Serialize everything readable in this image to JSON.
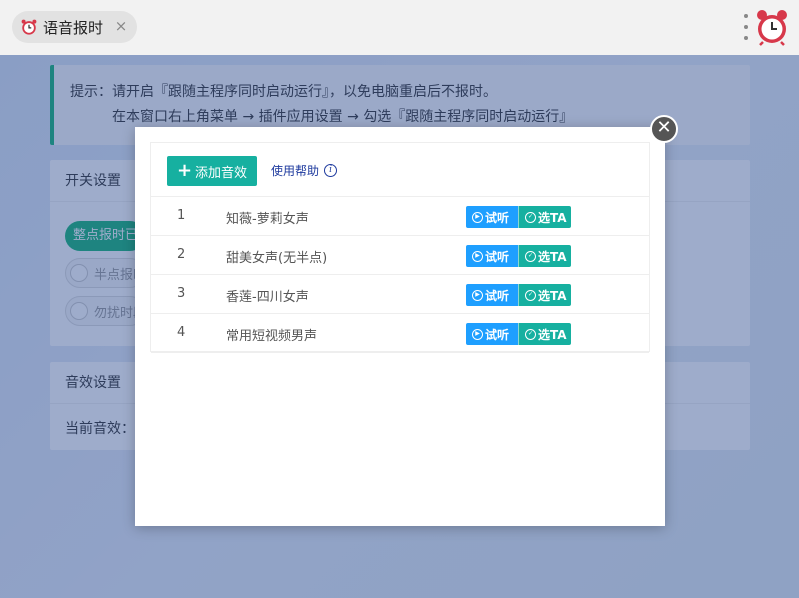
{
  "tab": {
    "title": "语音报时",
    "close": "×"
  },
  "hint": {
    "line1": "提示：请开启『跟随主程序同时启动运行』，以免电脑重启后不报时。",
    "line2": "在本窗口右上角菜单 → 插件应用设置 → 勾选『跟随主程序同时启动运行』"
  },
  "switch_card": {
    "title": "开关设置",
    "switch_label": "整点报时已开启",
    "option1": "半点报时",
    "option2": "勿扰时段"
  },
  "effect_card": {
    "title": "音效设置",
    "current_label": "当前音效："
  },
  "modal": {
    "add_button": "添加音效",
    "help_link": "使用帮助",
    "info_icon": "i",
    "close_icon": "✕",
    "listen_label": "试听",
    "pick_label": "选TA",
    "rows": [
      {
        "index": "1",
        "name": "知薇-萝莉女声"
      },
      {
        "index": "2",
        "name": "甜美女声(无半点)"
      },
      {
        "index": "3",
        "name": "香莲-四川女声"
      },
      {
        "index": "4",
        "name": "常用短视频男声"
      }
    ]
  },
  "colors": {
    "accent_green": "#16b777",
    "teal_button": "#16b0a0",
    "blue_button": "#1e9fff",
    "link_blue": "#1e3a9e"
  },
  "icons": {
    "tab_icon": "alarm-clock-icon",
    "app_icon": "alarm-clock-icon",
    "menu": "kebab-menu-icon",
    "listen": "play-circle-icon",
    "pick": "check-circle-icon"
  }
}
